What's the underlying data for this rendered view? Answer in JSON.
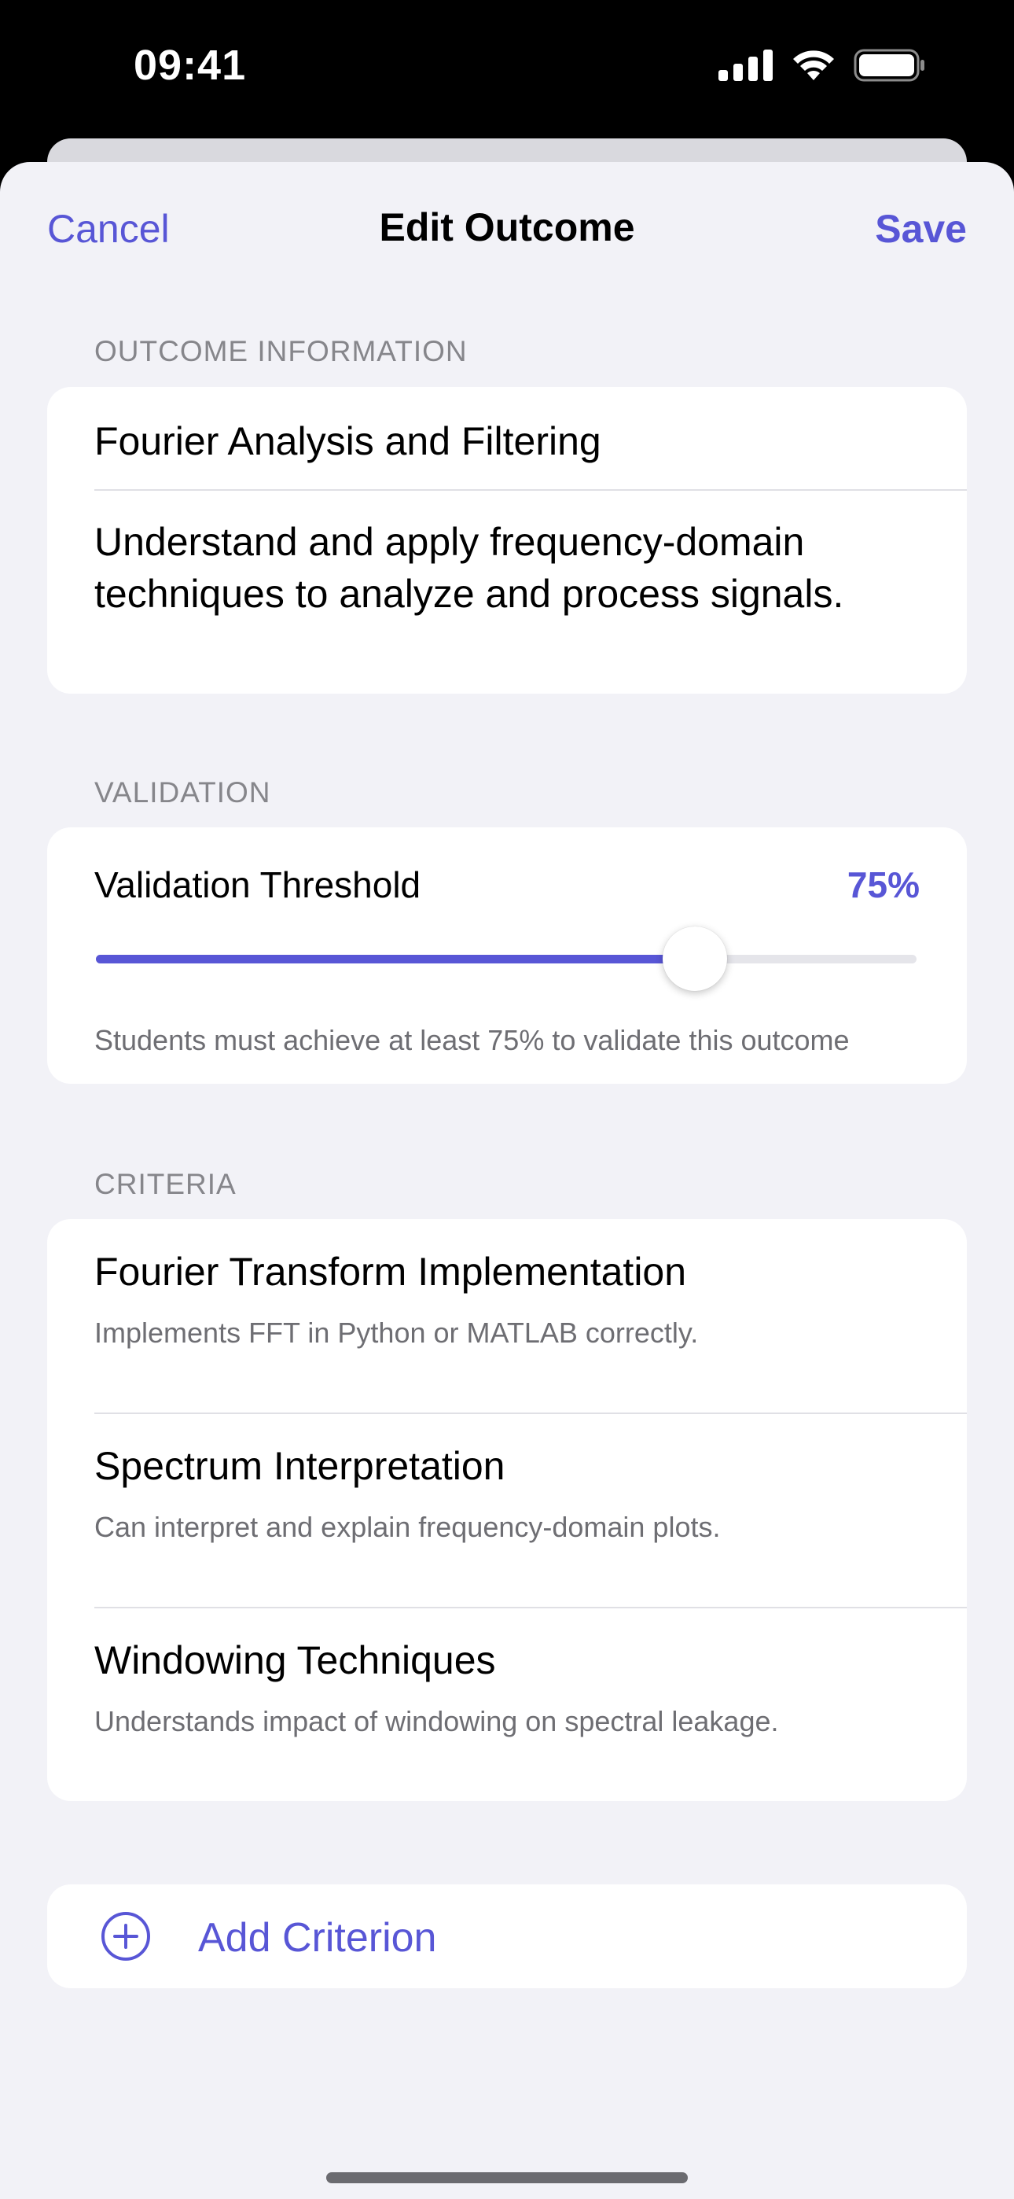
{
  "status_bar": {
    "time": "09:41",
    "icons": [
      "cellular-signal-icon",
      "wifi-icon",
      "battery-icon"
    ]
  },
  "nav": {
    "cancel_label": "Cancel",
    "title": "Edit Outcome",
    "save_label": "Save"
  },
  "outcome_section": {
    "header": "OUTCOME INFORMATION",
    "title_value": "Fourier Analysis and Filtering",
    "description_value": "Understand and apply frequency-domain techniques to analyze and process signals."
  },
  "validation_section": {
    "header": "VALIDATION",
    "label": "Validation Threshold",
    "value_text": "75%",
    "slider_fraction": 0.73,
    "helper": "Students must achieve at least 75% to validate this outcome"
  },
  "criteria_section": {
    "header": "CRITERIA",
    "items": [
      {
        "title": "Fourier Transform Implementation",
        "description": "Implements FFT in Python or MATLAB correctly."
      },
      {
        "title": "Spectrum Interpretation",
        "description": "Can interpret and explain frequency-domain plots."
      },
      {
        "title": "Windowing Techniques",
        "description": "Understands impact of windowing on spectral leakage."
      }
    ]
  },
  "add_criterion": {
    "label": "Add Criterion",
    "icon": "plus-circle-icon"
  },
  "colors": {
    "accent": "#5856d6",
    "background": "#f2f2f7",
    "card": "#ffffff",
    "secondary_text": "#6e6e73"
  }
}
